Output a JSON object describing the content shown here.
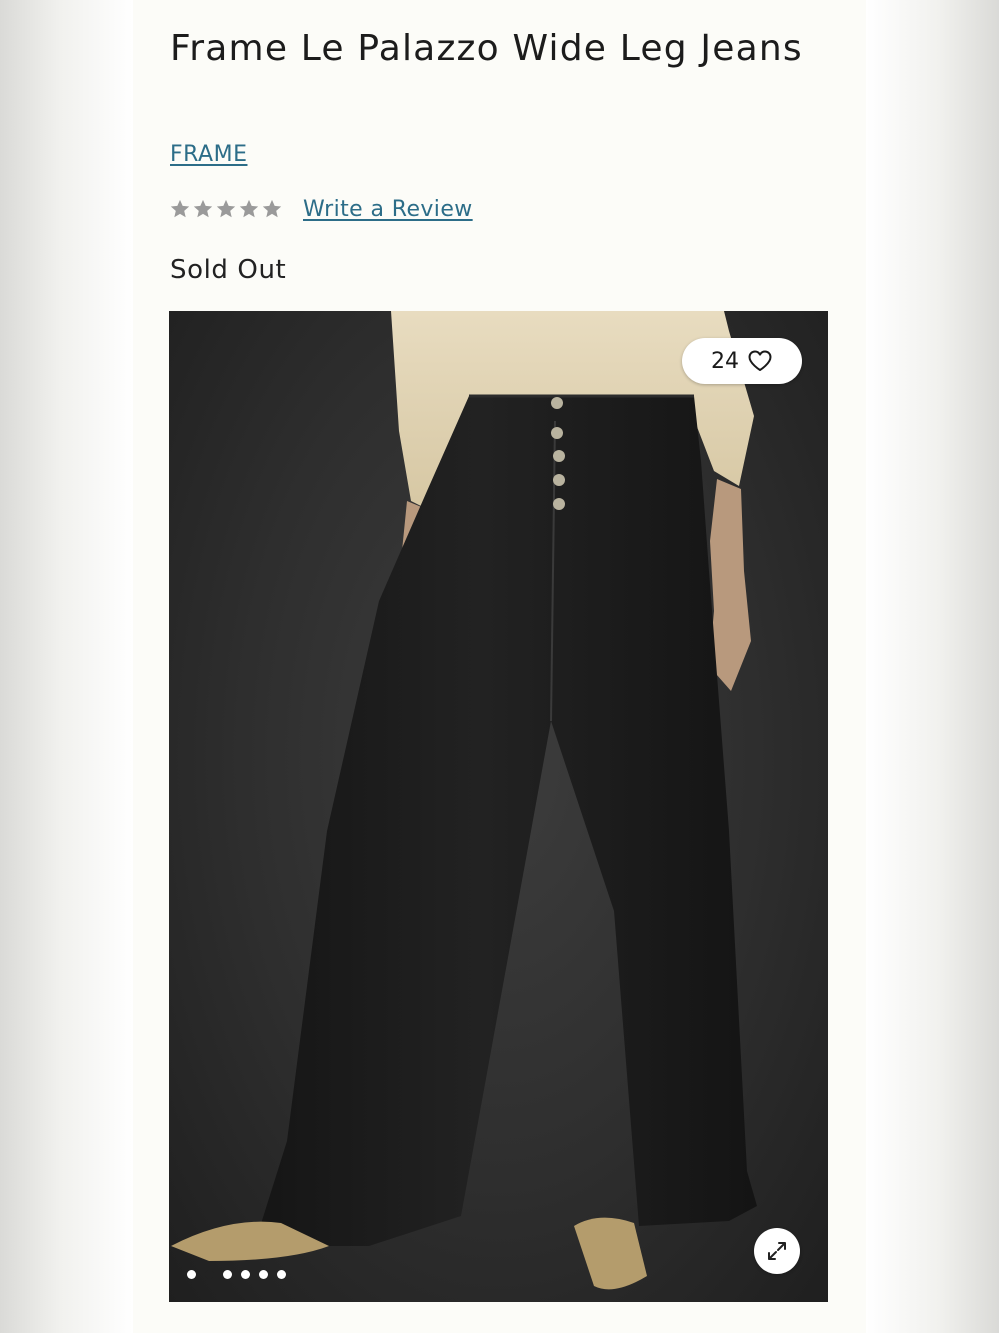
{
  "product": {
    "title": "Frame Le Palazzo Wide Leg Jeans",
    "brand": "FRAME",
    "rating": {
      "stars_filled": 0,
      "stars_total": 5,
      "review_link": "Write a Review"
    },
    "status": "Sold Out"
  },
  "gallery": {
    "wishlist_count": "24",
    "image_count": 6,
    "active_index": 1,
    "icons": {
      "wishlist": "heart-icon",
      "expand": "expand-icon"
    }
  },
  "colors": {
    "link": "#2c6d88",
    "star": "#9a9a9a",
    "page_background": "#fcfcf8"
  }
}
